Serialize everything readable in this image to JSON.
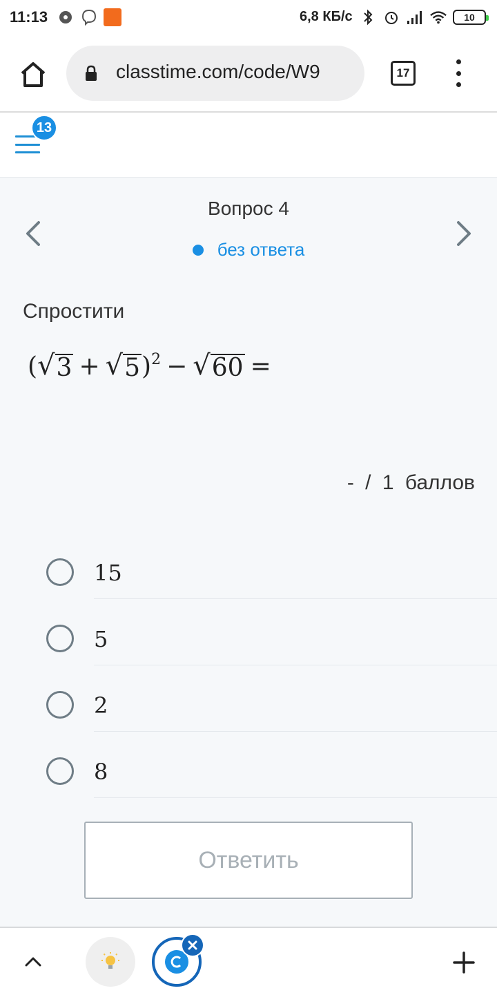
{
  "status_bar": {
    "time": "11:13",
    "speed": "6,8 КБ/с",
    "battery": "10",
    "icons": [
      "music-disc-icon",
      "viber-icon",
      "app-notification-icon",
      "bluetooth-icon",
      "alarm-icon",
      "signal-icon",
      "wifi-icon",
      "battery-icon"
    ]
  },
  "browser": {
    "url": "classtime.com/code/W9",
    "tab_count": "17"
  },
  "header": {
    "notification_count": "13"
  },
  "question": {
    "title": "Вопрос 4",
    "status": "без ответа",
    "status_color": "#1a8fe3",
    "prompt": "Спростити",
    "formula": {
      "open_paren": "(",
      "sqrt_a": "3",
      "plus": "+",
      "sqrt_b": "5",
      "close_paren": ")",
      "exponent": "2",
      "minus": "−",
      "sqrt_c": "60",
      "equals": "="
    },
    "points": "- / 1 баллов"
  },
  "options": [
    {
      "label": "15"
    },
    {
      "label": "5"
    },
    {
      "label": "2"
    },
    {
      "label": "8"
    }
  ],
  "submit": {
    "label": "Ответить"
  },
  "accent_color": "#1a8fe3"
}
